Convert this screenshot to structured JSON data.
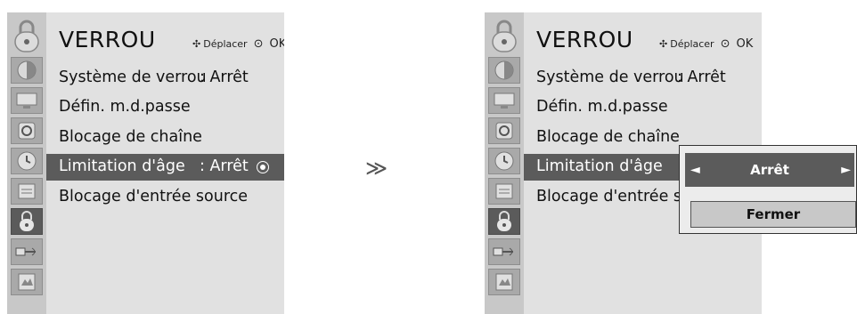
{
  "menu": {
    "title": "VERROU",
    "nav_move": "Déplacer",
    "nav_ok": "OK",
    "items": [
      {
        "label": "Système de verrou",
        "value": ": Arrêt"
      },
      {
        "label": "Défin. m.d.passe",
        "value": ""
      },
      {
        "label": "Blocage de chaîne",
        "value": ""
      },
      {
        "label": "Limitation d'âge",
        "value": ": Arrêt"
      },
      {
        "label": "Blocage d'entrée source",
        "value": ""
      }
    ],
    "right_items": [
      {
        "label": "Système de verrou",
        "value": ": Arrêt"
      },
      {
        "label": "Défin. m.d.passe",
        "value": ""
      },
      {
        "label": "Blocage de chaîne",
        "value": ""
      },
      {
        "label": "Limitation d'âge",
        "value": ":"
      },
      {
        "label": "Blocage d'entrée sou",
        "value": ""
      }
    ],
    "selected_index": 3
  },
  "step_arrow": "≫",
  "popup": {
    "value": "Arrêt",
    "left_arrow": "◄",
    "right_arrow": "►",
    "close_label": "Fermer"
  },
  "icons": [
    "lock-icon",
    "picture-icon",
    "screen-icon",
    "audio-icon",
    "time-icon",
    "option-icon",
    "lock-icon",
    "input-icon",
    "usb-icon"
  ],
  "colors": {
    "menu_bg": "#e1e1e1",
    "highlight": "#5b5b5b",
    "icon_column": "#c8c8c8"
  }
}
